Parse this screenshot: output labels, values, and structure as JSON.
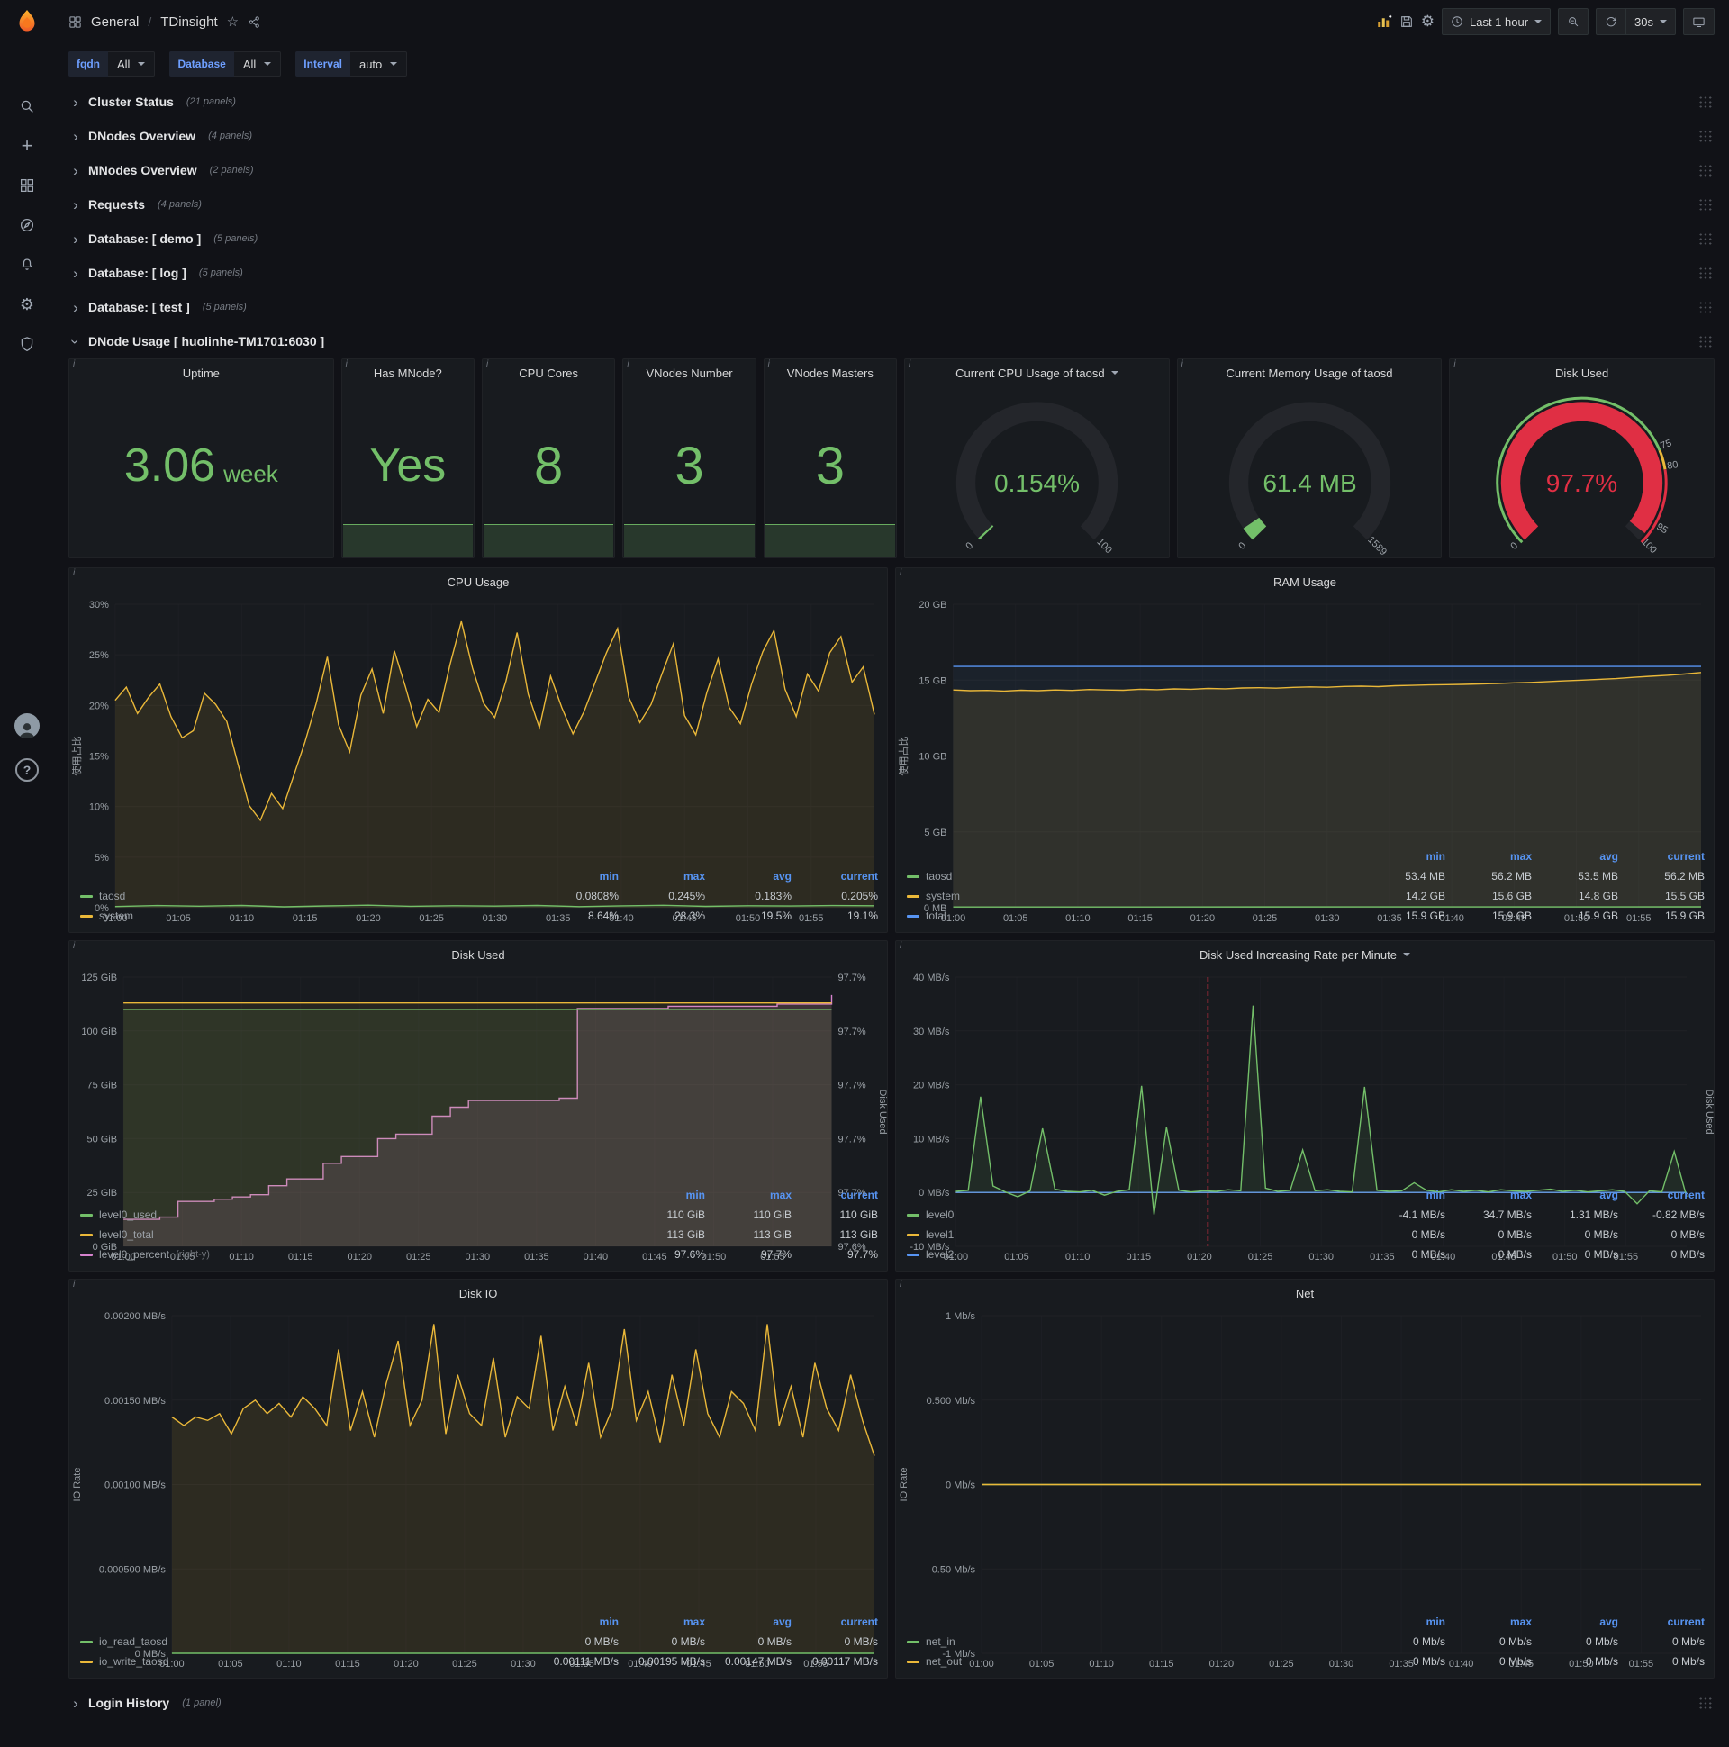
{
  "topnav": {
    "breadcrumb_section": "General",
    "breadcrumb_separator": "/",
    "breadcrumb_page": "TDinsight",
    "time_range_label": "Last 1 hour",
    "refresh_interval_label": "30s"
  },
  "icons": {
    "settings_glyph": "⚙",
    "star_glyph": "☆",
    "chevron_glyph": "›",
    "plus_glyph": "+",
    "help_glyph": "?",
    "info_glyph": "i"
  },
  "variables": [
    {
      "label": "fqdn",
      "value": "All"
    },
    {
      "label": "Database",
      "value": "All"
    },
    {
      "label": "Interval",
      "value": "auto"
    }
  ],
  "rows": [
    {
      "title": "Cluster Status",
      "count": "(21 panels)"
    },
    {
      "title": "DNodes Overview",
      "count": "(4 panels)"
    },
    {
      "title": "MNodes Overview",
      "count": "(2 panels)"
    },
    {
      "title": "Requests",
      "count": "(4 panels)"
    },
    {
      "title": "Database: [ demo ]",
      "count": "(5 panels)"
    },
    {
      "title": "Database: [ log ]",
      "count": "(5 panels)"
    },
    {
      "title": "Database: [ test ]",
      "count": "(5 panels)"
    }
  ],
  "expanded_row": {
    "title": "DNode Usage [ huolinhe-TM1701:6030 ]"
  },
  "bottom_row": {
    "title": "Login History",
    "count": "(1 panel)"
  },
  "stats": [
    {
      "title": "Uptime",
      "value": "3.06",
      "unit": "week"
    },
    {
      "title": "Has MNode?",
      "value": "Yes"
    },
    {
      "title": "CPU Cores",
      "value": "8"
    },
    {
      "title": "VNodes Number",
      "value": "3"
    },
    {
      "title": "VNodes Masters",
      "value": "3"
    }
  ],
  "gauges": [
    {
      "title": "Current CPU Usage of taosd",
      "has_menu": true,
      "value": "0.154%",
      "pct": 0.0015,
      "color": "#73bf69",
      "min_label": "0",
      "max_label": "100"
    },
    {
      "title": "Current Memory Usage of taosd",
      "value": "61.4 MB",
      "pct": 0.0386,
      "color": "#73bf69",
      "min_label": "0",
      "max_label": "1589"
    },
    {
      "title": "Disk Used",
      "value": "97.7%",
      "pct": 0.977,
      "color": "#e02f44",
      "min_label": "0",
      "max_label": "100",
      "ring": [
        {
          "to": 0.75,
          "color": "#73bf69"
        },
        {
          "to": 0.8,
          "color": "#eab839"
        },
        {
          "to": 1,
          "color": "#e02f44"
        }
      ],
      "thresholds": [
        {
          "label": "75",
          "g": 0.75
        },
        {
          "label": "80",
          "g": 0.8
        },
        {
          "label": "95",
          "g": 0.95
        }
      ]
    }
  ],
  "charts": [
    {
      "id": "cpu",
      "title": "CPU Usage",
      "ylabel_left": "使用占比",
      "x_ticks": [
        "01:00",
        "01:05",
        "01:10",
        "01:15",
        "01:20",
        "01:25",
        "01:30",
        "01:35",
        "01:40",
        "01:45",
        "01:50",
        "01:55"
      ],
      "y_left": {
        "labels": [
          "30%",
          "25%",
          "20%",
          "15%",
          "10%",
          "5%",
          "0%"
        ],
        "min": 0,
        "max": 30
      },
      "series": [
        {
          "name": "system",
          "color": "#eab839",
          "fill": 0.1,
          "points": [
            20.5,
            21.8,
            19.2,
            20.8,
            22.1,
            18.9,
            16.8,
            17.5,
            21.2,
            20.1,
            18.4,
            14.2,
            10.1,
            8.64,
            11.3,
            9.8,
            13.1,
            16.4,
            20.2,
            24.8,
            18.1,
            15.4,
            21.0,
            23.6,
            19.2,
            25.4,
            21.8,
            17.9,
            20.6,
            19.3,
            24.1,
            28.3,
            23.7,
            20.2,
            18.8,
            22.4,
            27.2,
            21.1,
            17.8,
            22.9,
            19.8,
            17.2,
            19.4,
            22.3,
            25.2,
            27.6,
            20.8,
            18.3,
            20.1,
            23.2,
            26.1,
            19.0,
            17.1,
            21.3,
            24.6,
            19.8,
            18.2,
            22.1,
            25.3,
            27.4,
            21.6,
            18.9,
            23.1,
            21.4,
            25.2,
            26.8,
            22.3,
            23.8,
            19.1
          ]
        },
        {
          "name": "taosd",
          "color": "#73bf69",
          "fill": 0.06,
          "points": [
            0.12,
            0.21,
            0.15,
            0.22,
            0.09,
            0.18,
            0.25,
            0.14,
            0.2,
            0.16,
            0.22,
            0.11,
            0.19,
            0.24,
            0.13,
            0.2,
            0.17,
            0.21,
            0.2
          ]
        }
      ],
      "legend": {
        "cols": [
          "min",
          "max",
          "avg",
          "current"
        ],
        "rows": [
          {
            "name": "taosd",
            "color": "#73bf69",
            "values": [
              "0.0808%",
              "0.245%",
              "0.183%",
              "0.205%"
            ]
          },
          {
            "name": "system",
            "color": "#eab839",
            "values": [
              "8.64%",
              "28.3%",
              "19.5%",
              "19.1%"
            ]
          }
        ]
      }
    },
    {
      "id": "ram",
      "title": "RAM Usage",
      "ylabel_left": "使用占比",
      "x_ticks": [
        "01:00",
        "01:05",
        "01:10",
        "01:15",
        "01:20",
        "01:25",
        "01:30",
        "01:35",
        "01:40",
        "01:45",
        "01:50",
        "01:55"
      ],
      "y_left": {
        "labels": [
          "20 GB",
          "15 GB",
          "10 GB",
          "5 GB",
          "0 MB"
        ],
        "min": 0,
        "max": 20
      },
      "series": [
        {
          "name": "total",
          "color": "#5794f2",
          "fill": 0.06,
          "points": [
            15.9,
            15.9
          ]
        },
        {
          "name": "system",
          "color": "#eab839",
          "fill": 0.1,
          "points": [
            14.35,
            14.3,
            14.32,
            14.28,
            14.33,
            14.3,
            14.35,
            14.32,
            14.38,
            14.35,
            14.33,
            14.4,
            14.37,
            14.42,
            14.4,
            14.45,
            14.43,
            14.48,
            14.5,
            14.47,
            14.52,
            14.55,
            14.53,
            14.58,
            14.6,
            14.57,
            14.63,
            14.65,
            14.68,
            14.7,
            14.72,
            14.75,
            14.78,
            14.82,
            14.85,
            14.9,
            14.95,
            15.0,
            15.05,
            15.1,
            15.18,
            15.25,
            15.32,
            15.4,
            15.5
          ]
        },
        {
          "name": "taosd",
          "color": "#73bf69",
          "fill": 0.05,
          "points": [
            0.05,
            0.06
          ]
        }
      ],
      "legend": {
        "cols": [
          "min",
          "max",
          "avg",
          "current"
        ],
        "rows": [
          {
            "name": "taosd",
            "color": "#73bf69",
            "values": [
              "53.4 MB",
              "56.2 MB",
              "53.5 MB",
              "56.2 MB"
            ]
          },
          {
            "name": "system",
            "color": "#eab839",
            "values": [
              "14.2 GB",
              "15.6 GB",
              "14.8 GB",
              "15.5 GB"
            ]
          },
          {
            "name": "total",
            "color": "#5794f2",
            "values": [
              "15.9 GB",
              "15.9 GB",
              "15.9 GB",
              "15.9 GB"
            ]
          }
        ]
      }
    },
    {
      "id": "disk",
      "title": "Disk Used",
      "ylabel_right": "Disk Used",
      "x_ticks": [
        "01:00",
        "01:05",
        "01:10",
        "01:15",
        "01:20",
        "01:25",
        "01:30",
        "01:35",
        "01:40",
        "01:45",
        "01:50",
        "01:55"
      ],
      "y_left": {
        "labels": [
          "125 GiB",
          "100 GiB",
          "75 GiB",
          "50 GiB",
          "25 GiB",
          "0 GiB"
        ],
        "min": 0,
        "max": 125
      },
      "y_right": {
        "labels": [
          "97.7%",
          "97.7%",
          "97.7%",
          "97.7%",
          "97.7%",
          "97.6%"
        ],
        "min": 97.59,
        "max": 97.71
      },
      "series": [
        {
          "name": "level0_percent",
          "color": "#d683ce",
          "fill": 0.14,
          "axis": "right",
          "step": true,
          "points": [
            97.602,
            97.602,
            97.603,
            97.61,
            97.61,
            97.611,
            97.612,
            97.613,
            97.617,
            97.62,
            97.62,
            97.627,
            97.63,
            97.63,
            97.638,
            97.64,
            97.64,
            97.648,
            97.652,
            97.655,
            97.655,
            97.655,
            97.655,
            97.655,
            97.656,
            97.696,
            97.696,
            97.696,
            97.696,
            97.696,
            97.697,
            97.697,
            97.697,
            97.697,
            97.697,
            97.697,
            97.698,
            97.698,
            97.698,
            97.702
          ]
        },
        {
          "name": "level0_total",
          "color": "#eab839",
          "fill": 0.07,
          "points": [
            113,
            113
          ]
        },
        {
          "name": "level0_used",
          "color": "#73bf69",
          "fill": 0.1,
          "points": [
            110,
            110
          ]
        }
      ],
      "legend": {
        "cols": [
          "min",
          "max",
          "current"
        ],
        "rows": [
          {
            "name": "level0_used",
            "color": "#73bf69",
            "values": [
              "110 GiB",
              "110 GiB",
              "110 GiB"
            ]
          },
          {
            "name": "level0_total",
            "color": "#eab839",
            "values": [
              "113 GiB",
              "113 GiB",
              "113 GiB"
            ]
          },
          {
            "name": "level0_percent",
            "color": "#d683ce",
            "extra": "(right-y)",
            "values": [
              "97.6%",
              "97.7%",
              "97.7%"
            ]
          }
        ]
      }
    },
    {
      "id": "rate",
      "title": "Disk Used Increasing Rate per Minute",
      "has_menu": true,
      "ylabel_right": "Disk Used",
      "annotation_x": 0.345,
      "x_ticks": [
        "01:00",
        "01:05",
        "01:10",
        "01:15",
        "01:20",
        "01:25",
        "01:30",
        "01:35",
        "01:40",
        "01:45",
        "01:50",
        "01:55"
      ],
      "y_left": {
        "labels": [
          "40 MB/s",
          "30 MB/s",
          "20 MB/s",
          "10 MB/s",
          "0 MB/s",
          "-10 MB/s"
        ],
        "min": -10,
        "max": 40
      },
      "series": [
        {
          "name": "level1",
          "color": "#eab839",
          "points": [
            0,
            0
          ]
        },
        {
          "name": "level2",
          "color": "#5794f2",
          "points": [
            0,
            0
          ]
        },
        {
          "name": "level0",
          "color": "#73bf69",
          "fill": 0.1,
          "points": [
            0.2,
            0.4,
            17.8,
            1.2,
            0.1,
            -0.8,
            0.3,
            11.9,
            0.6,
            0.2,
            0.1,
            0.4,
            -0.5,
            0.2,
            0.5,
            19.8,
            -4.1,
            12.1,
            0.4,
            0.1,
            0.3,
            0.2,
            0.5,
            0.3,
            34.7,
            0.8,
            0.2,
            0.4,
            7.9,
            0.3,
            0.5,
            0.2,
            0.1,
            19.6,
            0.4,
            0.2,
            0.3,
            1.8,
            0.4,
            0.1,
            0.5,
            0.2,
            0.4,
            0.1,
            0.5,
            0.3,
            0.2,
            0.4,
            0.6,
            0.2,
            0.4,
            0.1,
            0.3,
            0.5,
            0.2,
            -2.1,
            0.3,
            0.1,
            7.6,
            -0.82
          ]
        }
      ],
      "legend": {
        "cols": [
          "min",
          "max",
          "avg",
          "current"
        ],
        "rows": [
          {
            "name": "level0",
            "color": "#73bf69",
            "values": [
              "-4.1 MB/s",
              "34.7 MB/s",
              "1.31 MB/s",
              "-0.82 MB/s"
            ]
          },
          {
            "name": "level1",
            "color": "#eab839",
            "values": [
              "0 MB/s",
              "0 MB/s",
              "0 MB/s",
              "0 MB/s"
            ]
          },
          {
            "name": "level2",
            "color": "#5794f2",
            "values": [
              "0 MB/s",
              "0 MB/s",
              "0 MB/s",
              "0 MB/s"
            ]
          }
        ]
      }
    },
    {
      "id": "io",
      "title": "Disk IO",
      "ylabel_left": "IO Rate",
      "x_ticks": [
        "01:00",
        "01:05",
        "01:10",
        "01:15",
        "01:20",
        "01:25",
        "01:30",
        "01:35",
        "01:40",
        "01:45",
        "01:50",
        "01:55"
      ],
      "y_left": {
        "labels": [
          "0.00200 MB/s",
          "0.00150 MB/s",
          "0.00100 MB/s",
          "0.000500 MB/s",
          "0 MB/s"
        ],
        "min": 0,
        "max": 0.002
      },
      "series": [
        {
          "name": "io_write_taosd",
          "color": "#eab839",
          "fill": 0.1,
          "points": [
            0.0014,
            0.00135,
            0.0014,
            0.00138,
            0.00142,
            0.0013,
            0.00145,
            0.0015,
            0.00142,
            0.00148,
            0.0014,
            0.00152,
            0.00145,
            0.00135,
            0.0018,
            0.00132,
            0.00155,
            0.00128,
            0.0016,
            0.00185,
            0.00135,
            0.0015,
            0.00195,
            0.0013,
            0.00165,
            0.00142,
            0.00135,
            0.00175,
            0.00128,
            0.00152,
            0.00145,
            0.00188,
            0.00132,
            0.00158,
            0.00135,
            0.00172,
            0.00128,
            0.00145,
            0.00192,
            0.00138,
            0.00155,
            0.00125,
            0.00165,
            0.00135,
            0.0018,
            0.00142,
            0.00128,
            0.00155,
            0.00148,
            0.00132,
            0.00195,
            0.00135,
            0.00158,
            0.00128,
            0.00172,
            0.00145,
            0.00132,
            0.00165,
            0.00138,
            0.00117
          ]
        },
        {
          "name": "io_read_taosd",
          "color": "#73bf69",
          "points": [
            0,
            0
          ]
        }
      ],
      "legend": {
        "cols": [
          "min",
          "max",
          "avg",
          "current"
        ],
        "rows": [
          {
            "name": "io_read_taosd",
            "color": "#73bf69",
            "values": [
              "0 MB/s",
              "0 MB/s",
              "0 MB/s",
              "0 MB/s"
            ]
          },
          {
            "name": "io_write_taosd",
            "color": "#eab839",
            "values": [
              "0.00111 MB/s",
              "0.00195 MB/s",
              "0.00147 MB/s",
              "0.00117 MB/s"
            ]
          }
        ]
      }
    },
    {
      "id": "net",
      "title": "Net",
      "ylabel_left": "IO Rate",
      "x_ticks": [
        "01:00",
        "01:05",
        "01:10",
        "01:15",
        "01:20",
        "01:25",
        "01:30",
        "01:35",
        "01:40",
        "01:45",
        "01:50",
        "01:55"
      ],
      "y_left": {
        "labels": [
          "1 Mb/s",
          "0.500 Mb/s",
          "0 Mb/s",
          "-0.50 Mb/s",
          "-1 Mb/s"
        ],
        "min": -1,
        "max": 1
      },
      "series": [
        {
          "name": "net_in",
          "color": "#73bf69",
          "points": [
            0,
            0
          ]
        },
        {
          "name": "net_out",
          "color": "#eab839",
          "points": [
            0,
            0
          ]
        }
      ],
      "legend": {
        "cols": [
          "min",
          "max",
          "avg",
          "current"
        ],
        "rows": [
          {
            "name": "net_in",
            "color": "#73bf69",
            "values": [
              "0 Mb/s",
              "0 Mb/s",
              "0 Mb/s",
              "0 Mb/s"
            ]
          },
          {
            "name": "net_out",
            "color": "#eab839",
            "values": [
              "0 Mb/s",
              "0 Mb/s",
              "0 Mb/s",
              "0 Mb/s"
            ]
          }
        ]
      }
    }
  ],
  "colors": {
    "page_bg": "#111217",
    "panel_bg": "#181b1f",
    "green": "#73bf69",
    "yellow": "#eab839",
    "blue": "#5794f2",
    "red": "#e02f44",
    "pink": "#d683ce",
    "legend_header": "#5794f2"
  }
}
